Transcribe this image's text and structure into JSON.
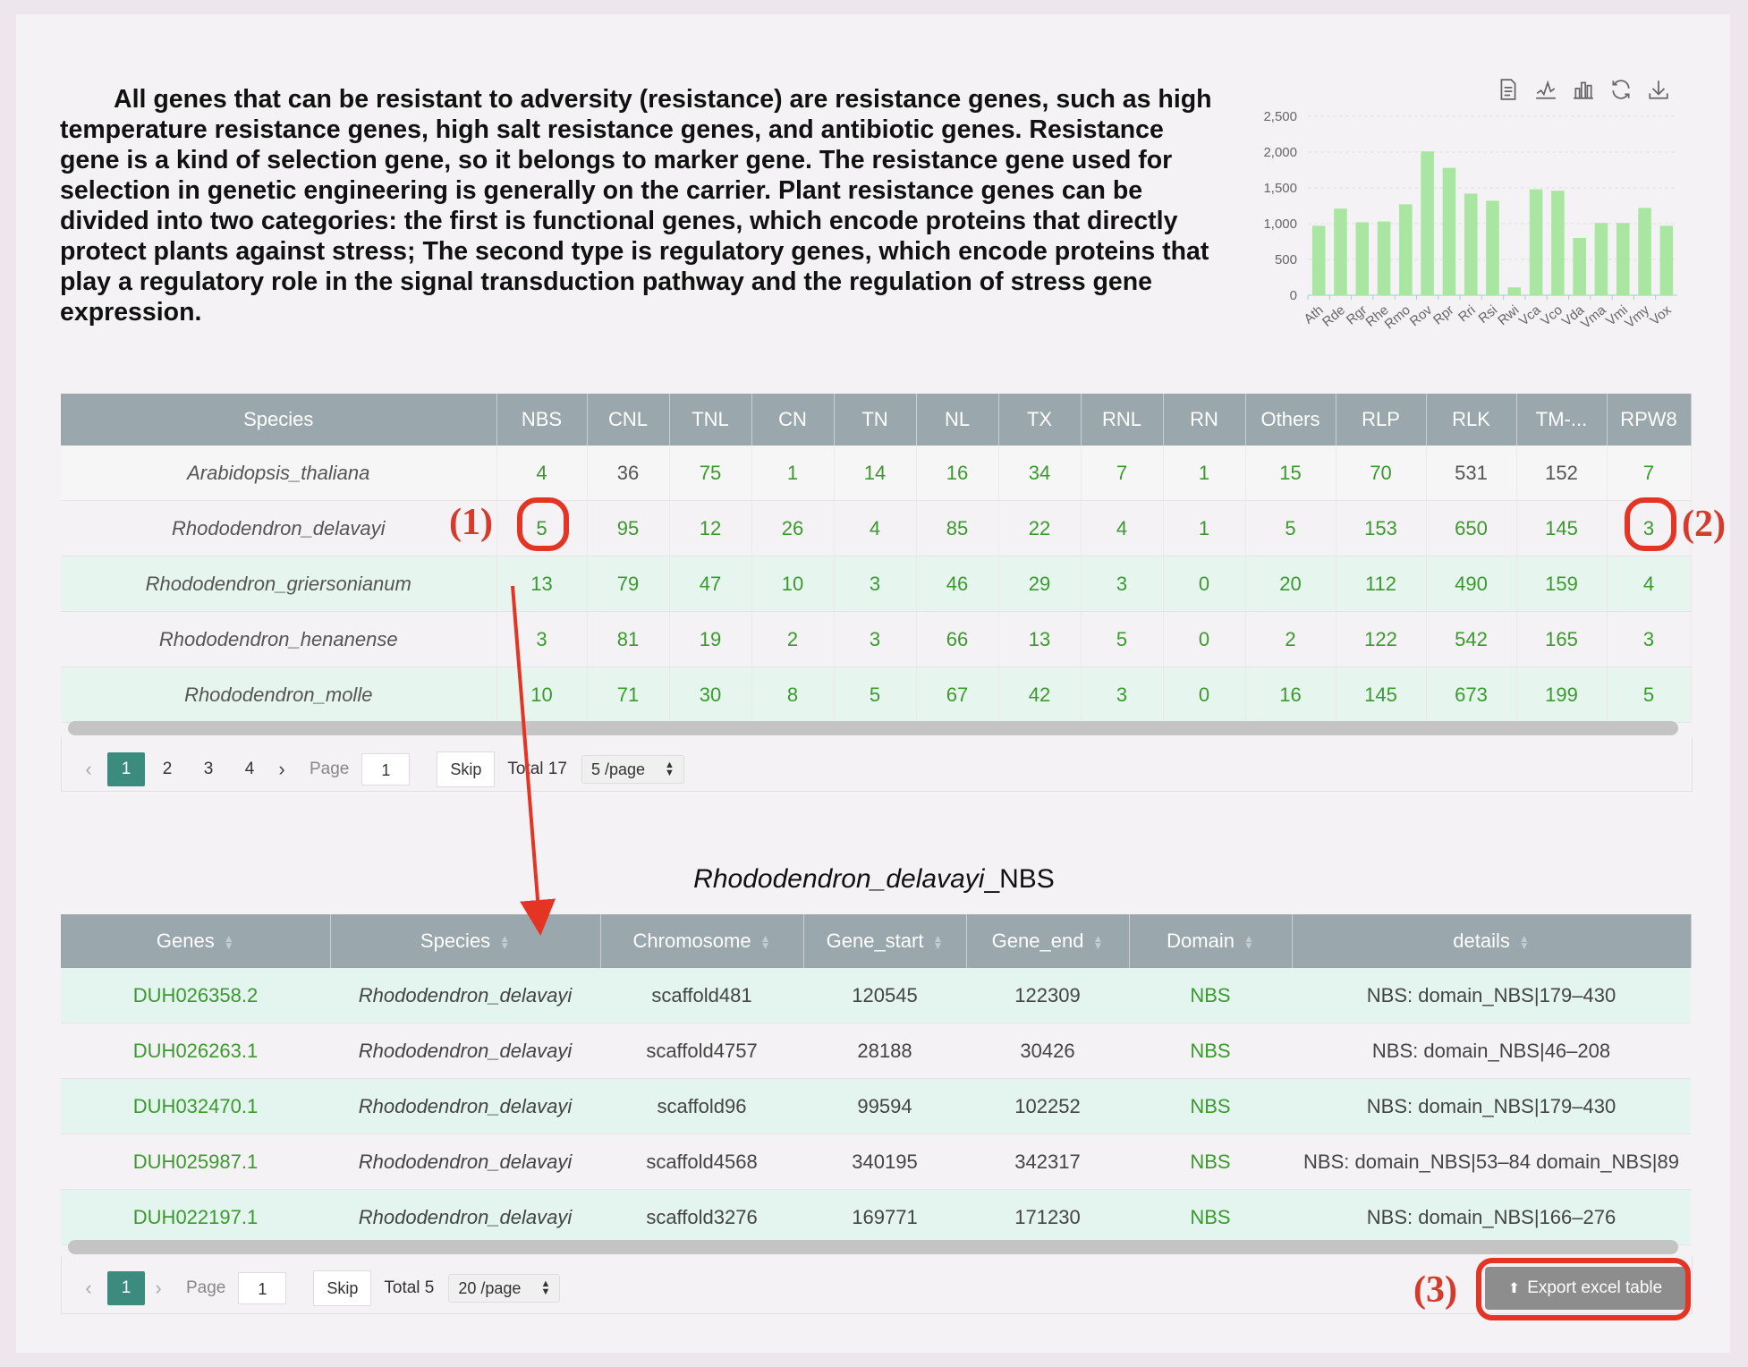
{
  "intro_text": "All genes that can be resistant to adversity (resistance) are resistance genes, such as high temperature resistance genes, high salt resistance genes, and antibiotic genes. Resistance gene is a kind of selection gene, so it belongs to marker gene. The resistance gene used for selection in genetic engineering is generally on the carrier. Plant resistance genes can be divided into two categories: the first is functional genes, which encode proteins that directly protect plants against stress; The second type is regulatory genes, which encode proteins that play a regulatory role in the signal transduction pathway and the regulation of stress gene expression.",
  "chart_tools": [
    "data-view-icon",
    "line-chart-icon",
    "bar-chart-icon",
    "refresh-icon",
    "download-icon"
  ],
  "chart_data": {
    "type": "bar",
    "categories": [
      "Ath",
      "Rde",
      "Rgr",
      "Rhe",
      "Rmo",
      "Rov",
      "Rpr",
      "Rri",
      "Rsi",
      "Rwi",
      "Vca",
      "Vco",
      "Vda",
      "Vma",
      "Vmi",
      "Vmy",
      "Vox"
    ],
    "values": [
      970,
      1210,
      1020,
      1030,
      1270,
      2010,
      1780,
      1420,
      1320,
      110,
      1480,
      1460,
      800,
      1010,
      1010,
      1220,
      970
    ],
    "ylim": [
      0,
      2500
    ],
    "yticks": [
      "0",
      "500",
      "1,000",
      "1,500",
      "2,000",
      "2,500"
    ],
    "bar_color": "#a8e6a1",
    "grid": true
  },
  "table1": {
    "headers": [
      "Species",
      "NBS",
      "CNL",
      "TNL",
      "CN",
      "TN",
      "NL",
      "TX",
      "RNL",
      "RN",
      "Others",
      "RLP",
      "RLK",
      "TM-...",
      "RPW8"
    ],
    "rows": [
      [
        "Arabidopsis_thaliana",
        "4",
        "36",
        "75",
        "1",
        "14",
        "16",
        "34",
        "7",
        "1",
        "15",
        "70",
        "531",
        "152",
        "7"
      ],
      [
        "Rhododendron_delavayi",
        "5",
        "95",
        "12",
        "26",
        "4",
        "85",
        "22",
        "4",
        "1",
        "5",
        "153",
        "650",
        "145",
        "3"
      ],
      [
        "Rhododendron_griersonianum",
        "13",
        "79",
        "47",
        "10",
        "3",
        "46",
        "29",
        "3",
        "0",
        "20",
        "112",
        "490",
        "159",
        "4"
      ],
      [
        "Rhododendron_henanense",
        "3",
        "81",
        "19",
        "2",
        "3",
        "66",
        "13",
        "5",
        "0",
        "2",
        "122",
        "542",
        "165",
        "3"
      ],
      [
        "Rhododendron_molle",
        "10",
        "71",
        "30",
        "8",
        "5",
        "67",
        "42",
        "3",
        "0",
        "16",
        "145",
        "673",
        "199",
        "5"
      ]
    ]
  },
  "pager1": {
    "pages": [
      "1",
      "2",
      "3",
      "4"
    ],
    "active": "1",
    "page_label": "Page",
    "page_value": "1",
    "skip": "Skip",
    "total": "Total 17",
    "per_page": "5 /page"
  },
  "subtable_title_species": "Rhododendron_delavayi",
  "subtable_title_suffix": "_NBS",
  "table2": {
    "headers": [
      "Genes",
      "Species",
      "Chromosome",
      "Gene_start",
      "Gene_end",
      "Domain",
      "details"
    ],
    "rows": [
      [
        "DUH026358.2",
        "Rhododendron_delavayi",
        "scaffold481",
        "120545",
        "122309",
        "NBS",
        "NBS: domain_NBS|179–430"
      ],
      [
        "DUH026263.1",
        "Rhododendron_delavayi",
        "scaffold4757",
        "28188",
        "30426",
        "NBS",
        "NBS: domain_NBS|46–208"
      ],
      [
        "DUH032470.1",
        "Rhododendron_delavayi",
        "scaffold96",
        "99594",
        "102252",
        "NBS",
        "NBS: domain_NBS|179–430"
      ],
      [
        "DUH025987.1",
        "Rhododendron_delavayi",
        "scaffold4568",
        "340195",
        "342317",
        "NBS",
        "NBS: domain_NBS|53–84 domain_NBS|89"
      ],
      [
        "DUH022197.1",
        "Rhododendron_delavayi",
        "scaffold3276",
        "169771",
        "171230",
        "NBS",
        "NBS: domain_NBS|166–276"
      ]
    ]
  },
  "pager2": {
    "pages": [
      "1"
    ],
    "active": "1",
    "page_label": "Page",
    "page_value": "1",
    "skip": "Skip",
    "total": "Total 5",
    "per_page": "20 /page"
  },
  "export_label": "Export excel table",
  "annotations": [
    "(1)",
    "(2)",
    "(3)"
  ],
  "annotation_color": "#d63a2a"
}
